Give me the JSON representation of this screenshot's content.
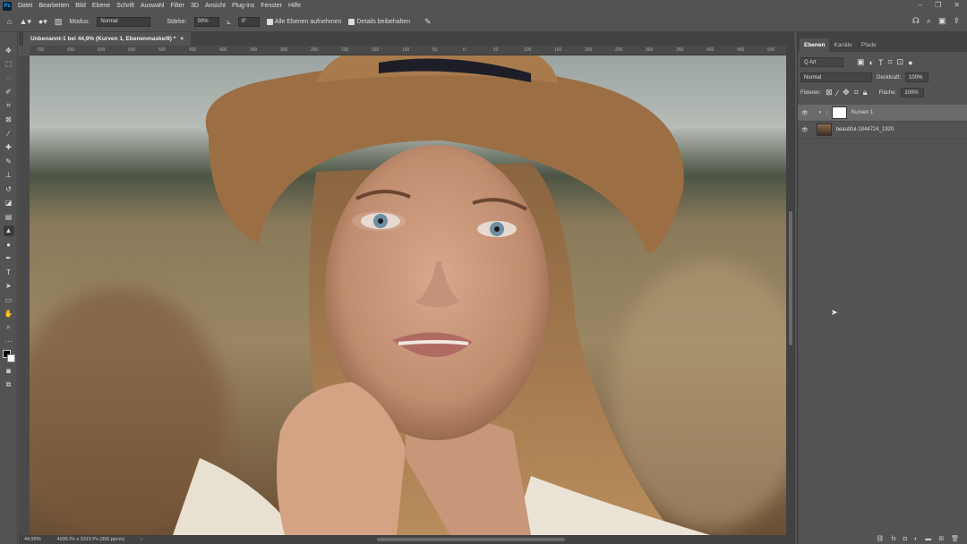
{
  "app": {
    "logo": "Ps"
  },
  "menu": [
    "Datei",
    "Bearbeiten",
    "Bild",
    "Ebene",
    "Schrift",
    "Auswahl",
    "Filter",
    "3D",
    "Ansicht",
    "Plug-ins",
    "Fenster",
    "Hilfe"
  ],
  "options": {
    "mode_label": "Modus:",
    "mode_value": "Normal",
    "strength_label": "Stärke:",
    "strength_value": "50%",
    "angle_value": "0°",
    "sample_all_layers": "Alle Ebenen aufnehmen",
    "keep_details": "Details beibehalten",
    "brush_size": "13"
  },
  "document": {
    "tab_title": "Unbenannt-1 bei 44,9% (Kurven 1, Ebenenmaske/8) *",
    "close": "×"
  },
  "ruler": [
    "700",
    "650",
    "600",
    "550",
    "500",
    "450",
    "400",
    "350",
    "300",
    "250",
    "200",
    "150",
    "100",
    "50",
    "0",
    "50",
    "100",
    "150",
    "200",
    "250",
    "300",
    "350",
    "400",
    "450",
    "500"
  ],
  "status": {
    "zoom": "44,95%",
    "size": "4936 Px x 3319 Px (300 ppcm)",
    "arrow": "›"
  },
  "panel": {
    "tabs": [
      "Ebenen",
      "Kanäle",
      "Pfade"
    ],
    "filter_value": "Q Art",
    "blend_mode": "Normal",
    "opacity_label": "Deckkraft:",
    "opacity_value": "100%",
    "lock_label": "Fixieren:",
    "fill_label": "Fläche:",
    "fill_value": "100%",
    "layers": [
      {
        "name": "Kurven 1",
        "selected": true,
        "visible": true
      },
      {
        "name": "beautiful-1844724_1920",
        "selected": false,
        "visible": true
      }
    ]
  },
  "colors": {
    "ui_bg": "#535353",
    "panel_dark": "#424242",
    "selected_layer": "#6a6a6a"
  }
}
